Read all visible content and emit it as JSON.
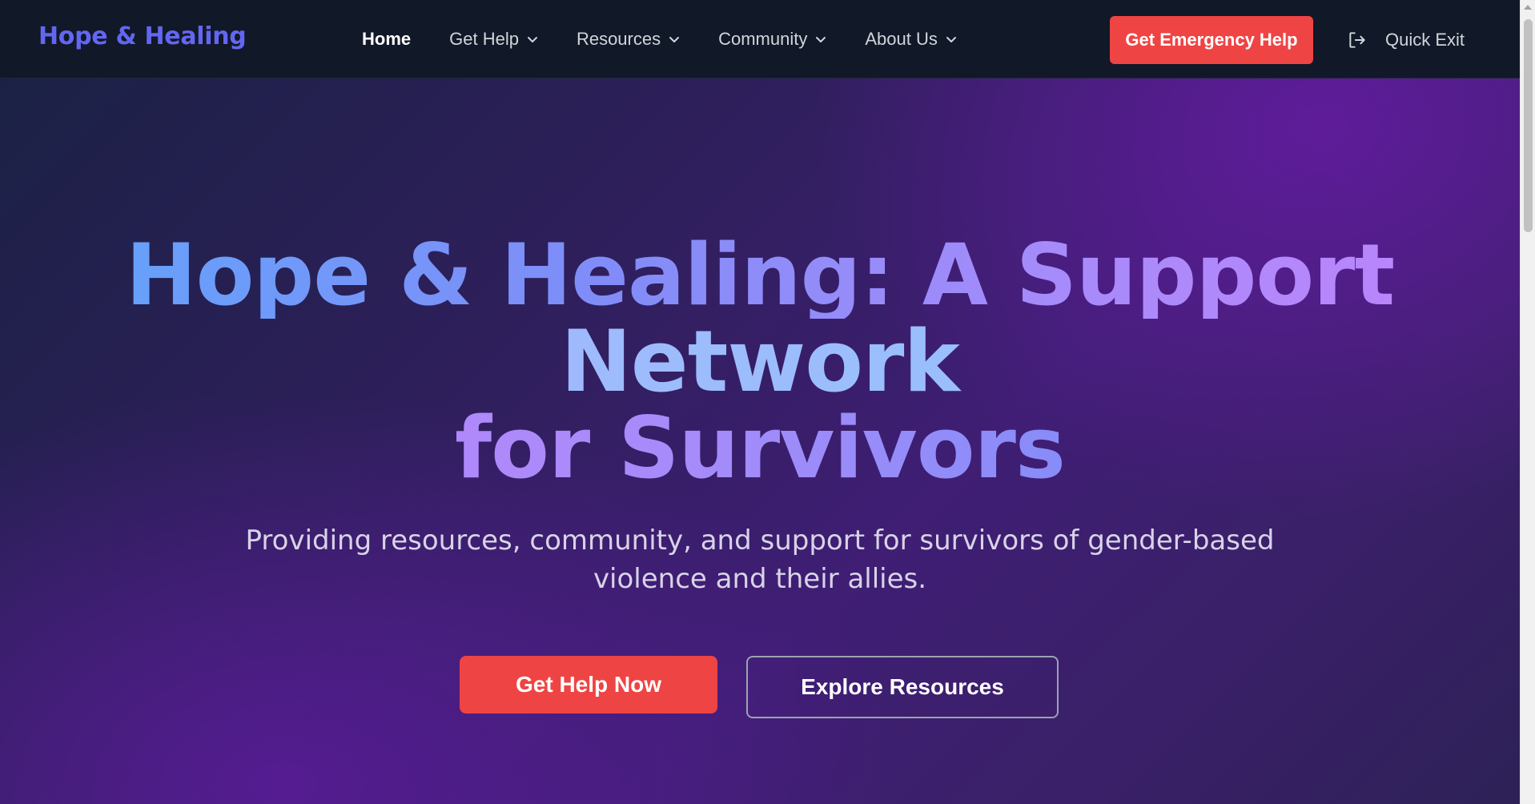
{
  "nav": {
    "brand": "Hope & Healing",
    "items": [
      {
        "label": "Home",
        "active": true,
        "dropdown": false
      },
      {
        "label": "Get Help",
        "active": false,
        "dropdown": true
      },
      {
        "label": "Resources",
        "active": false,
        "dropdown": true
      },
      {
        "label": "Community",
        "active": false,
        "dropdown": true
      },
      {
        "label": "About Us",
        "active": false,
        "dropdown": true
      }
    ],
    "emergency_label": "Get Emergency Help",
    "quick_exit_label": "Quick Exit",
    "quick_exit_icon": "exit-icon"
  },
  "hero": {
    "title_line1": "Hope & Healing: A Support",
    "title_line2": "Network",
    "title_line3": "for Survivors",
    "subtitle": "Providing resources, community, and support for survivors of gender-based violence and their allies.",
    "primary_cta": "Get Help Now",
    "secondary_cta": "Explore Resources"
  },
  "colors": {
    "brand": "#6366f1",
    "emergency": "#ef4444",
    "nav_bg": "#111827",
    "gradient_blue": "#60a5fa",
    "gradient_purple": "#c084fc"
  }
}
